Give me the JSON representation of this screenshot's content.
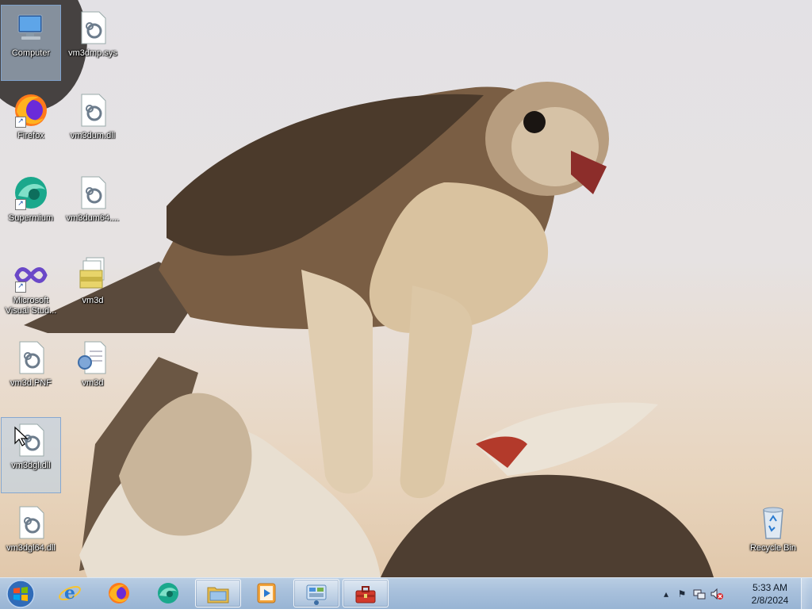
{
  "desktop": {
    "icons": [
      {
        "label": "Computer",
        "icon": "computer-icon"
      },
      {
        "label": "vm3dmp.sys",
        "icon": "system-file-icon"
      },
      {
        "label": "Firefox",
        "icon": "firefox-icon"
      },
      {
        "label": "vm3dum.dll",
        "icon": "system-file-icon"
      },
      {
        "label": "Supermium",
        "icon": "supermium-icon"
      },
      {
        "label": "vm3dum64....",
        "icon": "system-file-icon"
      },
      {
        "label": "Microsoft Visual Stud...",
        "icon": "visual-studio-icon"
      },
      {
        "label": "vm3d",
        "icon": "setup-files-icon"
      },
      {
        "label": "vm3d.PNF",
        "icon": "system-file-icon"
      },
      {
        "label": "vm3d",
        "icon": "setup-info-icon"
      },
      {
        "label": "vm3dgl.dll",
        "icon": "system-file-icon"
      },
      {
        "label": "vm3dgl64.dll",
        "icon": "system-file-icon"
      },
      {
        "label": "Recycle Bin",
        "icon": "recycle-bin-icon"
      }
    ]
  },
  "taskbar": {
    "start": {
      "icon": "windows-start-icon"
    },
    "pinned": [
      {
        "name": "Internet Explorer",
        "icon": "internet-explorer-icon"
      },
      {
        "name": "Firefox",
        "icon": "firefox-icon"
      },
      {
        "name": "Supermium",
        "icon": "supermium-icon"
      },
      {
        "name": "File Explorer",
        "icon": "folder-icon"
      },
      {
        "name": "Media Player",
        "icon": "media-player-icon"
      },
      {
        "name": "Control Panel",
        "icon": "control-panel-icon"
      },
      {
        "name": "Toolbox",
        "icon": "toolbox-icon"
      }
    ],
    "tray": {
      "icons": [
        "show-hidden-icons-arrow",
        "action-center-flag-icon",
        "network-icon",
        "volume-muted-icon"
      ],
      "time": "5:33 AM",
      "date": "2/8/2024"
    }
  },
  "colors": {
    "taskbar": "#a9c1dc",
    "selection": "#b9d1ea",
    "label_text": "#ffffff"
  }
}
